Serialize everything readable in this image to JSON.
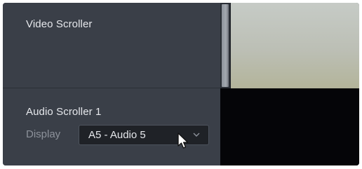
{
  "video_scroller": {
    "title": "Video Scroller"
  },
  "audio_scroller": {
    "title": "Audio Scroller 1",
    "display_label": "Display",
    "display_value": "A5 - Audio 5"
  },
  "icons": {
    "dropdown": "chevron-down-icon",
    "pointer": "mouse-cursor-icon"
  },
  "colors": {
    "panel_bg": "#3a3f48",
    "dropdown_bg": "#1f2227",
    "text_primary": "#e6e8ec",
    "text_secondary": "#8d929b",
    "audio_area_bg": "#050508",
    "video_preview_bg": "#bcbfb5"
  }
}
